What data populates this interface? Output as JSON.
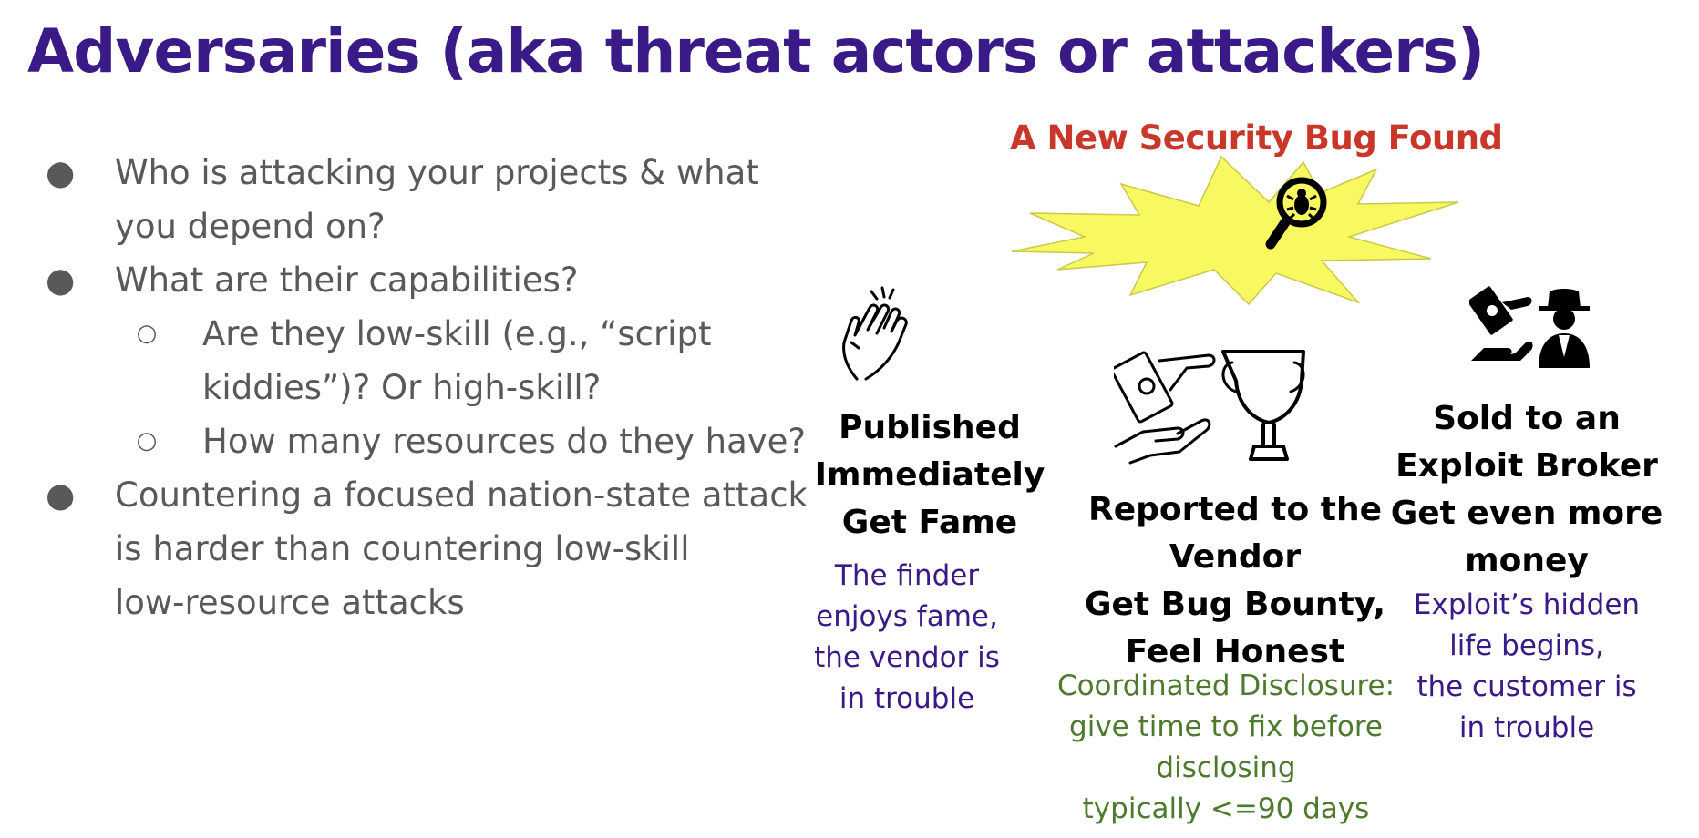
{
  "title": "Adversaries (aka threat actors or attackers)",
  "bullets": [
    {
      "level": 1,
      "lines": [
        "Who is attacking your projects & what",
        "you depend on?"
      ]
    },
    {
      "level": 1,
      "lines": [
        "What are their capabilities?"
      ]
    },
    {
      "level": 2,
      "lines": [
        "Are they low-skill (e.g., “script",
        "kiddies”)? Or high-skill?"
      ]
    },
    {
      "level": 2,
      "lines": [
        "How many resources do they have?"
      ]
    },
    {
      "level": 1,
      "lines": [
        "Countering a focused nation-state attack",
        "is harder than countering low-skill",
        "low-resource attacks"
      ]
    }
  ],
  "bullet_marks": {
    "level1": "●",
    "level2": "○"
  },
  "diagram": {
    "heading": "A New Security Bug Found",
    "burst_color": "#f8f860",
    "outcomes": [
      {
        "icon": "clapping-hands-icon",
        "title_lines": [
          "Published",
          "Immediately",
          "Get Fame"
        ],
        "desc_lines": [
          "The finder",
          "enjoys fame,",
          "the vendor is",
          "in trouble"
        ],
        "desc_color": "#3a1a86"
      },
      {
        "icon": "money-hand-trophy-icon",
        "title_lines": [
          "Reported to the",
          "Vendor",
          "Get Bug Bounty,",
          "Feel Honest"
        ],
        "desc_lines": [
          "Coordinated Disclosure:",
          "give time to fix before",
          "disclosing",
          "typically <=90 days"
        ],
        "desc_color": "#4e7a2e"
      },
      {
        "icon": "broker-money-icon",
        "title_lines": [
          "Sold to an",
          "Exploit Broker",
          "Get even more",
          "money"
        ],
        "desc_lines": [
          "Exploit’s hidden",
          "life begins,",
          "the customer is",
          "in trouble"
        ],
        "desc_color": "#3a1a86"
      }
    ]
  }
}
